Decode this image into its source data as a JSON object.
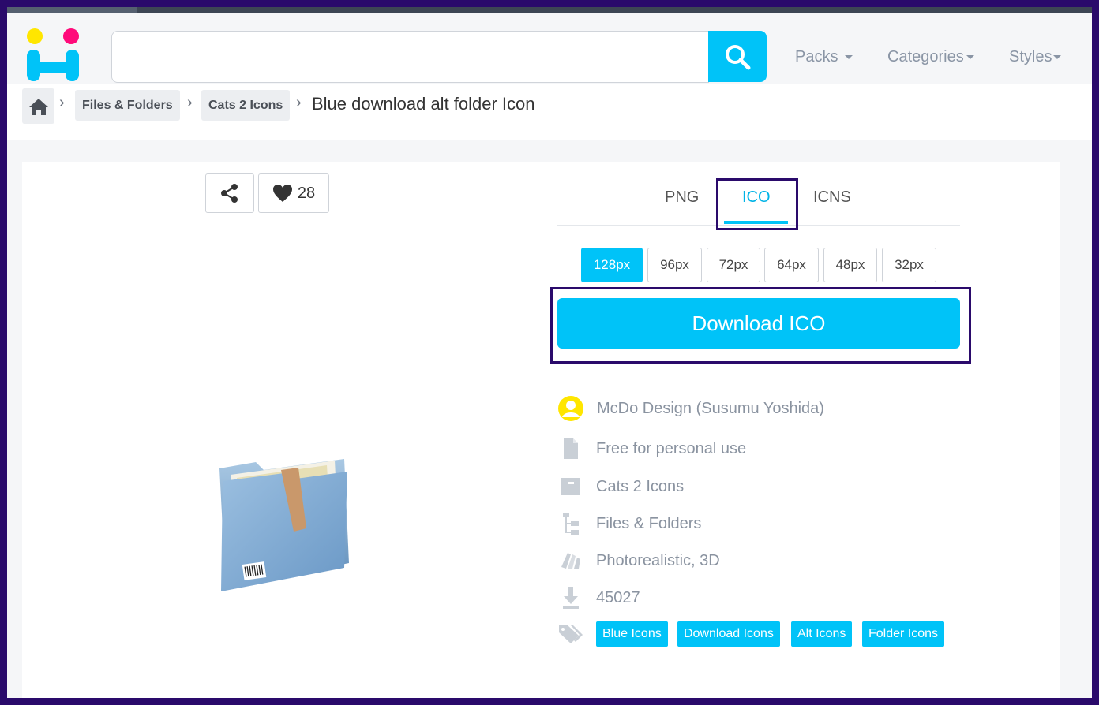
{
  "header": {
    "search": {
      "placeholder": ""
    },
    "nav": [
      {
        "label": "Packs"
      },
      {
        "label": "Categories"
      },
      {
        "label": "Styles"
      }
    ]
  },
  "breadcrumb": {
    "items": [
      {
        "label": "Files & Folders"
      },
      {
        "label": "Cats 2 Icons"
      }
    ],
    "current": "Blue download alt folder Icon"
  },
  "icon_actions": {
    "likes": "28"
  },
  "formats": {
    "tabs": [
      {
        "label": "PNG"
      },
      {
        "label": "ICO"
      },
      {
        "label": "ICNS"
      }
    ],
    "active_tab": "ICO",
    "sizes": [
      "128px",
      "96px",
      "72px",
      "64px",
      "48px",
      "32px"
    ],
    "active_size": "128px",
    "download_label": "Download ICO"
  },
  "info": {
    "author": "McDo Design (Susumu Yoshida)",
    "license": "Free for personal use",
    "pack": "Cats 2 Icons",
    "category": "Files & Folders",
    "styles": "Photorealistic, 3D",
    "downloads": "45027"
  },
  "tags": [
    "Blue Icons",
    "Download Icons",
    "Alt Icons",
    "Folder Icons"
  ],
  "colors": {
    "accent": "#00c3f8",
    "highlight": "#2a0a6b",
    "logo_yellow": "#ffe600",
    "logo_pink": "#ff0a7a"
  }
}
